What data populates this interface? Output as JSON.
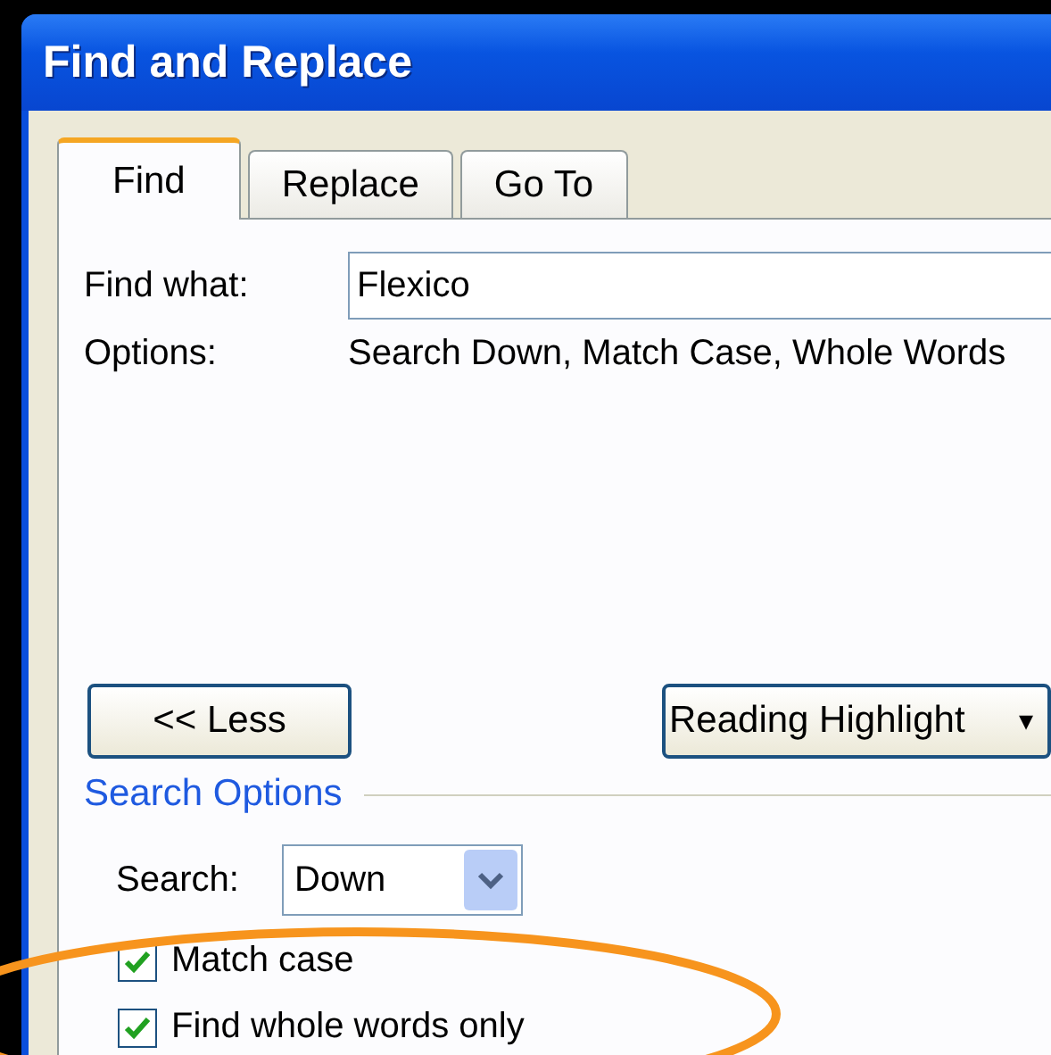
{
  "window": {
    "title": "Find and Replace"
  },
  "tabs": [
    {
      "label": "Find",
      "selected": true
    },
    {
      "label": "Replace",
      "selected": false
    },
    {
      "label": "Go To",
      "selected": false
    }
  ],
  "find_what": {
    "label": "Find what:",
    "value": "Flexico"
  },
  "options": {
    "label": "Options:",
    "value": "Search Down, Match Case, Whole Words"
  },
  "less_button": {
    "label": "<< Less"
  },
  "reading_highlight": {
    "label": "Reading Highlight",
    "caret": "▾"
  },
  "search_options": {
    "title": "Search Options",
    "search_label": "Search:",
    "search_value": "Down"
  },
  "checkboxes": [
    {
      "label": "Match case",
      "checked": true
    },
    {
      "label": "Find whole words only",
      "checked": true
    }
  ],
  "annotation": {
    "kind": "ellipse"
  }
}
